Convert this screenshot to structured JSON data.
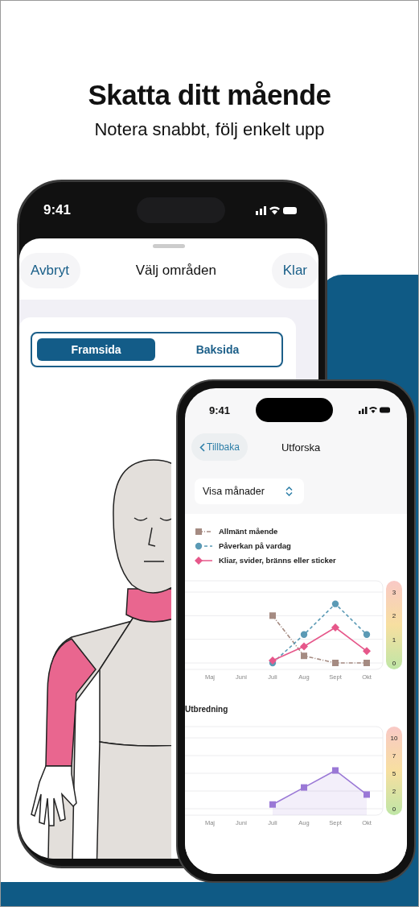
{
  "headline": {
    "title": "Skatta ditt mående",
    "subtitle": "Notera snabbt, följ enkelt upp"
  },
  "back_phone": {
    "status_time": "9:41",
    "cancel": "Avbryt",
    "title": "Välj områden",
    "done": "Klar",
    "segments": [
      {
        "label": "Framsida",
        "selected": true
      },
      {
        "label": "Baksida",
        "selected": false
      }
    ]
  },
  "front_phone": {
    "status_time": "9:41",
    "back": "Tillbaka",
    "title": "Utforska",
    "period_picker": "Visa månader",
    "charts": [
      {
        "chart_data": {
          "type": "line",
          "categories": [
            "Maj",
            "Juni",
            "Juli",
            "Aug",
            "Sept",
            "Okt"
          ],
          "ylim": [
            0,
            3
          ],
          "yticks": [
            0,
            1,
            2,
            3
          ],
          "series": [
            {
              "name": "Allmänt mående",
              "color": "#a58b82",
              "marker": "square",
              "line_style": "dashdot",
              "values": [
                null,
                null,
                2,
                0.3,
                0,
                0
              ]
            },
            {
              "name": "Påverkan på vardag",
              "color": "#5b9ab5",
              "marker": "circle",
              "line_style": "dashed",
              "values": [
                null,
                null,
                0,
                1.2,
                2.5,
                1.2
              ]
            },
            {
              "name": "Kliar, svider, bränns eller sticker",
              "color": "#e6578a",
              "marker": "diamond",
              "line_style": "solid",
              "values": [
                null,
                null,
                0.1,
                0.7,
                1.5,
                0.5
              ]
            }
          ],
          "grid": true
        }
      },
      {
        "chart_data": {
          "type": "area",
          "title": "Utbredning",
          "categories": [
            "Maj",
            "Juni",
            "Juli",
            "Aug",
            "Sept",
            "Okt"
          ],
          "ylim": [
            0,
            10
          ],
          "yticks": [
            {
              "value": 0,
              "label": "0"
            },
            {
              "value": 2.5,
              "label": "2"
            },
            {
              "value": 5,
              "label": "5"
            },
            {
              "value": 7.5,
              "label": "7"
            },
            {
              "value": 10,
              "label": "10"
            }
          ],
          "series": [
            {
              "color": "#9a78d6",
              "marker": "square",
              "line_style": "solid",
              "values": [
                null,
                null,
                0.6,
                3,
                5.4,
                2
              ]
            }
          ],
          "grid": true
        }
      }
    ]
  }
}
